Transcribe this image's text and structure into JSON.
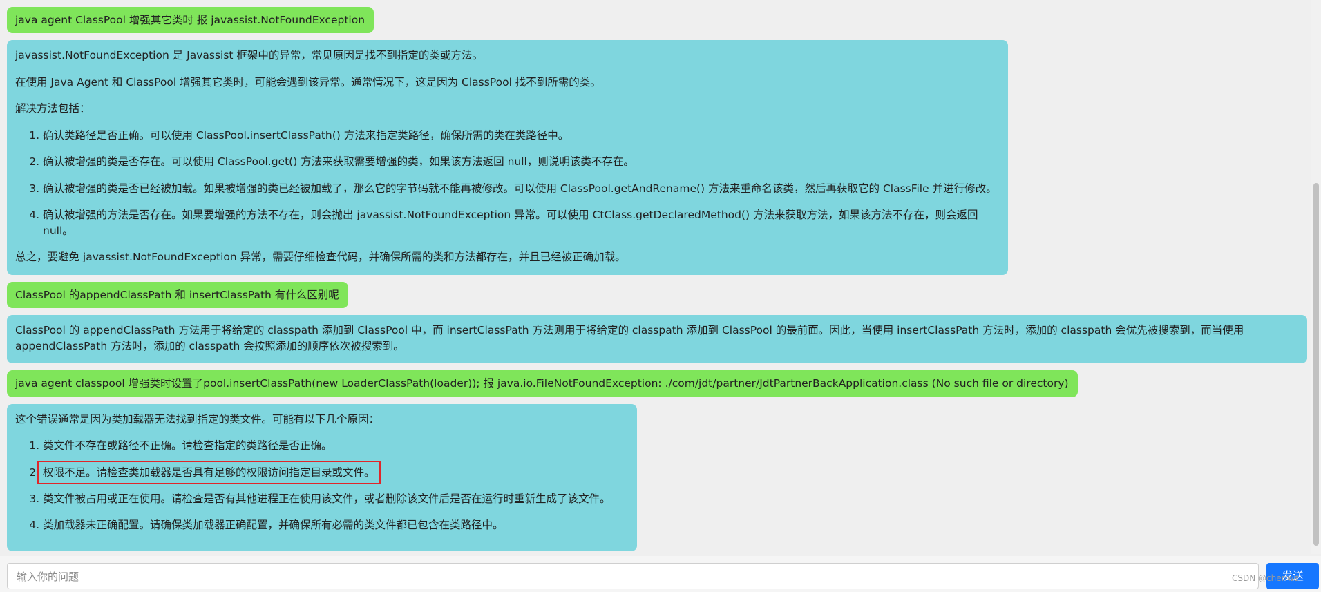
{
  "messages": [
    {
      "role": "user",
      "text": "java agent ClassPool 增强其它类时 报 javassist.NotFoundException"
    },
    {
      "role": "assistant",
      "intro": [
        "javassist.NotFoundException 是 Javassist 框架中的异常，常见原因是找不到指定的类或方法。",
        "在使用 Java Agent 和 ClassPool 增强其它类时，可能会遇到该异常。通常情况下，这是因为 ClassPool 找不到所需的类。",
        "解决方法包括："
      ],
      "list": [
        "确认类路径是否正确。可以使用 ClassPool.insertClassPath() 方法来指定类路径，确保所需的类在类路径中。",
        "确认被增强的类是否存在。可以使用 ClassPool.get() 方法来获取需要增强的类，如果该方法返回 null，则说明该类不存在。",
        "确认被增强的类是否已经被加载。如果被增强的类已经被加载了，那么它的字节码就不能再被修改。可以使用 ClassPool.getAndRename() 方法来重命名该类，然后再获取它的 ClassFile 并进行修改。",
        "确认被增强的方法是否存在。如果要增强的方法不存在，则会抛出 javassist.NotFoundException 异常。可以使用 CtClass.getDeclaredMethod() 方法来获取方法，如果该方法不存在，则会返回 null。"
      ],
      "outro": "总之，要避免 javassist.NotFoundException 异常，需要仔细检查代码，并确保所需的类和方法都存在，并且已经被正确加载。"
    },
    {
      "role": "user",
      "text": "ClassPool 的appendClassPath 和 insertClassPath 有什么区别呢"
    },
    {
      "role": "assistant",
      "intro": [
        "ClassPool 的 appendClassPath 方法用于将给定的 classpath 添加到 ClassPool 中，而 insertClassPath 方法则用于将给定的 classpath 添加到 ClassPool 的最前面。因此，当使用 insertClassPath 方法时，添加的 classpath 会优先被搜索到，而当使用 appendClassPath 方法时，添加的 classpath 会按照添加的顺序依次被搜索到。"
      ]
    },
    {
      "role": "user",
      "text": "java agent classpool 增强类时设置了pool.insertClassPath(new LoaderClassPath(loader)); 报 java.io.FileNotFoundException: ./com/jdt/partner/JdtPartnerBackApplication.class (No such file or directory)"
    },
    {
      "role": "assistant",
      "intro": [
        "这个错误通常是因为类加载器无法找到指定的类文件。可能有以下几个原因："
      ],
      "list": [
        "类文件不存在或路径不正确。请检查指定的类路径是否正确。",
        "权限不足。请检查类加载器是否具有足够的权限访问指定目录或文件。",
        "类文件被占用或正在使用。请检查是否有其他进程正在使用该文件，或者删除该文件后是否在运行时重新生成了该文件。",
        "类加载器未正确配置。请确保类加载器正确配置，并确保所有必需的类文件都已包含在类路径中。"
      ]
    }
  ],
  "input": {
    "placeholder": "输入你的问题"
  },
  "send_label": "发送",
  "watermark": "CSDN @cheriwa",
  "colors": {
    "user_bubble": "#7fe55a",
    "assistant_bubble": "#7fd6de",
    "send_button": "#1677ff",
    "highlight_box": "#e0262a"
  }
}
